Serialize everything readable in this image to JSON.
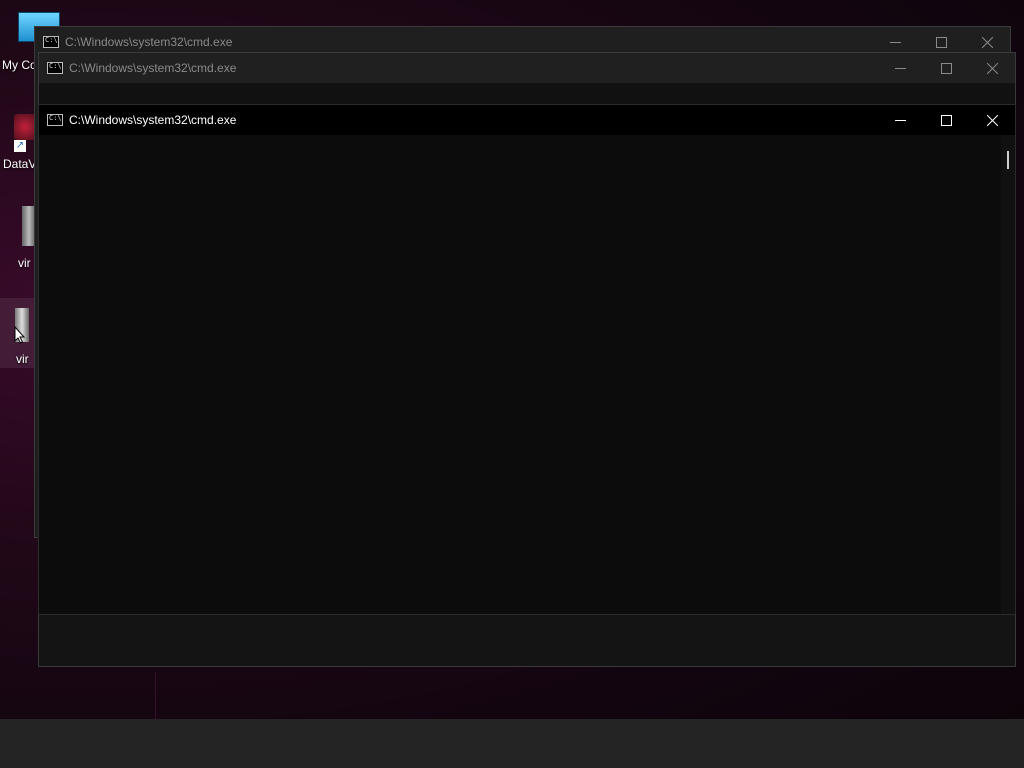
{
  "desktop": {
    "icons": [
      {
        "label": "My Co"
      },
      {
        "label": "DataV"
      },
      {
        "label": "vir"
      },
      {
        "label": "vir"
      }
    ]
  },
  "windows": [
    {
      "title": "C:\\Windows\\system32\\cmd.exe",
      "state": "inactive"
    },
    {
      "title": "C:\\Windows\\system32\\cmd.exe",
      "state": "inactive"
    },
    {
      "title": "C:\\Windows\\system32\\cmd.exe",
      "state": "active"
    }
  ],
  "icons": {
    "app": "cmd-icon",
    "minimize": "minimize-icon",
    "maximize": "maximize-icon",
    "close": "close-icon"
  },
  "colors": {
    "console_bg": "#0c0c0c",
    "title_active": "#ffffff",
    "title_inactive": "#8a8a8a",
    "taskbar": "#242424"
  }
}
